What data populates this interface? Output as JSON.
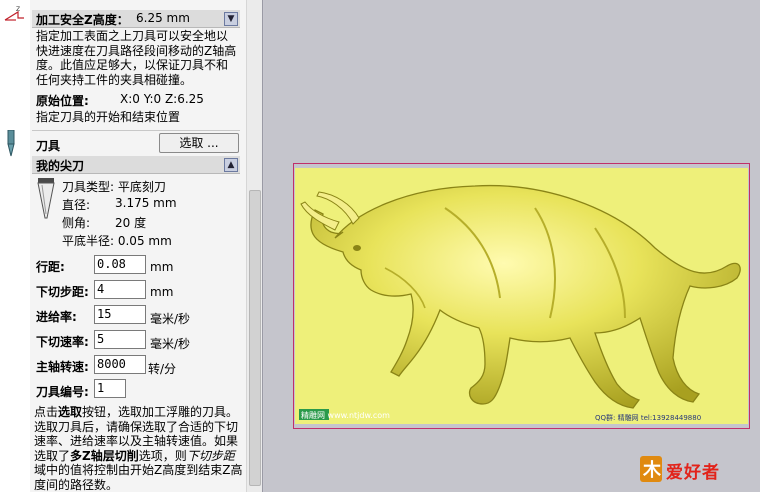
{
  "safe_z": {
    "label": "加工安全Z高度：",
    "value": "6.25 mm",
    "desc": [
      "指定加工表面之上刀具可以安全地以",
      "快进速度在刀具路径段间移动的Z轴高",
      "度。此值应足够大，以保证刀具不和",
      "任何夹持工件的夹具相碰撞。"
    ]
  },
  "home": {
    "label": "原始位置:",
    "value": "X:0 Y:0 Z:6.25",
    "desc": "指定刀具的开始和结束位置"
  },
  "tool": {
    "label": "刀具",
    "select_button": "选取 ..."
  },
  "my_tool": {
    "title": "我的尖刀",
    "type": "刀具类型: 平底刻刀",
    "diameter_label": "直径:",
    "diameter_value": "3.175 mm",
    "angle_label": "侧角:",
    "angle_value": "20 度",
    "flat_radius": "平底半径: 0.05 mm"
  },
  "params": [
    {
      "label": "行距:",
      "value": "0.08",
      "unit": "mm"
    },
    {
      "label": "下切步距:",
      "value": "4",
      "unit": "mm"
    },
    {
      "label": "进给率:",
      "value": "15",
      "unit": "毫米/秒"
    },
    {
      "label": "下切速率:",
      "value": "5",
      "unit": "毫米/秒"
    },
    {
      "label": "主轴转速:",
      "value": "8000",
      "unit": "转/分"
    },
    {
      "label": "刀具编号:",
      "value": "1",
      "unit": ""
    }
  ],
  "help": {
    "l1a": "点击",
    "l1b": "选取",
    "l1c": "按钮，选取加工浮雕的刀具。",
    "l2": "选取刀具后，请确保选取了合适的下切",
    "l3": "速率、进给速率以及主轴转速值。如果",
    "l4a": "选取了",
    "l4b": "多Z轴层切削",
    "l4c": "选项，则",
    "l4d": "下切步距",
    "l5": "域中的值将控制由开始Z高度到结束Z高",
    "l6": "度间的路径数。"
  },
  "viewport": {
    "watermark_left": "精雕网 www.ntjdw.com",
    "watermark_right": "QQ群: 精雕网 tel:13928449880",
    "logo": "爱好者"
  },
  "colors": {
    "relief": "#eef07a",
    "frame": "#c0306a",
    "viewport_bg": "#c5c5cc"
  }
}
